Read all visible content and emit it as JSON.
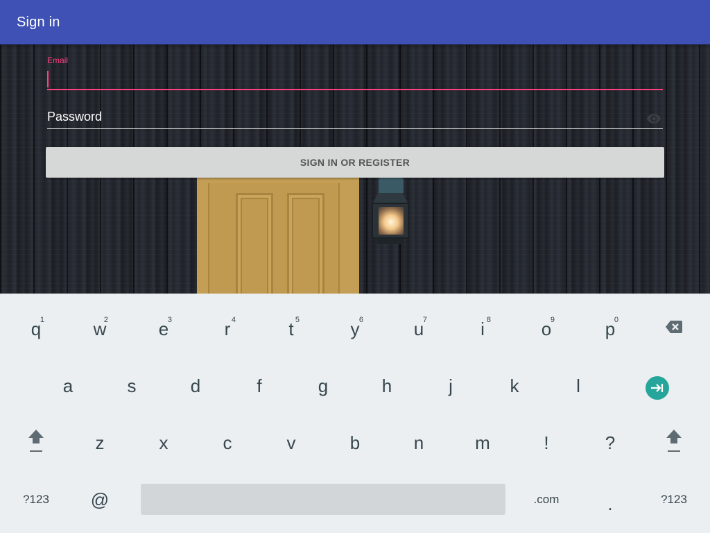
{
  "appbar": {
    "title": "Sign in"
  },
  "form": {
    "email_label": "Email",
    "email_value": "",
    "password_placeholder": "Password",
    "submit_label": "SIGN IN OR REGISTER"
  },
  "keyboard": {
    "row1": [
      {
        "key": "q",
        "hint": "1"
      },
      {
        "key": "w",
        "hint": "2"
      },
      {
        "key": "e",
        "hint": "3"
      },
      {
        "key": "r",
        "hint": "4"
      },
      {
        "key": "t",
        "hint": "5"
      },
      {
        "key": "y",
        "hint": "6"
      },
      {
        "key": "u",
        "hint": "7"
      },
      {
        "key": "i",
        "hint": "8"
      },
      {
        "key": "o",
        "hint": "9"
      },
      {
        "key": "p",
        "hint": "0"
      }
    ],
    "row2": [
      "a",
      "s",
      "d",
      "f",
      "g",
      "h",
      "j",
      "k",
      "l"
    ],
    "row3": [
      "z",
      "x",
      "c",
      "v",
      "b",
      "n",
      "m",
      "!",
      "?"
    ],
    "row4": {
      "symbols_left": "?123",
      "at": "@",
      "dotcom": ".com",
      "period": ".",
      "symbols_right": "?123"
    },
    "icons": {
      "backspace": "backspace-icon",
      "enter": "next-field-icon",
      "shift": "shift-icon",
      "password_toggle": "eye-icon"
    },
    "accent_color": "#26a69a"
  },
  "colors": {
    "appbar": "#3f51b5",
    "accent": "#ff4081"
  }
}
